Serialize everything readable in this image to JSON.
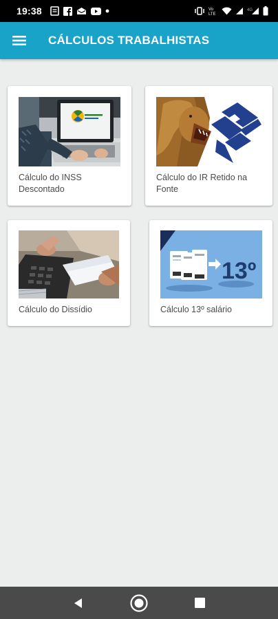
{
  "status_bar": {
    "time": "19:38",
    "left_icons": [
      "notes-icon",
      "facebook-icon",
      "mail-icon",
      "youtube-icon",
      "dot-icon"
    ],
    "right_icons": [
      "vibrate-icon",
      "volte-icon",
      "wifi-icon",
      "signal-icon",
      "signal-4g-icon",
      "battery-icon"
    ]
  },
  "app_bar": {
    "menu_icon": "hamburger-menu-icon",
    "title": "CÁLCULOS TRABALHISTAS",
    "color": "#1aa3c8"
  },
  "cards": [
    {
      "label": "Cálculo do INSS Descontado",
      "image": "inss-laptop-image"
    },
    {
      "label": "Cálculo do IR Retido na Fonte",
      "image": "lion-receita-image"
    },
    {
      "label": "Cálculo do Dissídio",
      "image": "calculator-hands-image"
    },
    {
      "label": "Cálculo 13º salário",
      "image": "thirteenth-salary-image",
      "image_text": "13º"
    }
  ],
  "nav_bar": {
    "back_icon": "back-triangle-icon",
    "home_icon": "home-circle-icon",
    "recents_icon": "recents-square-icon"
  }
}
